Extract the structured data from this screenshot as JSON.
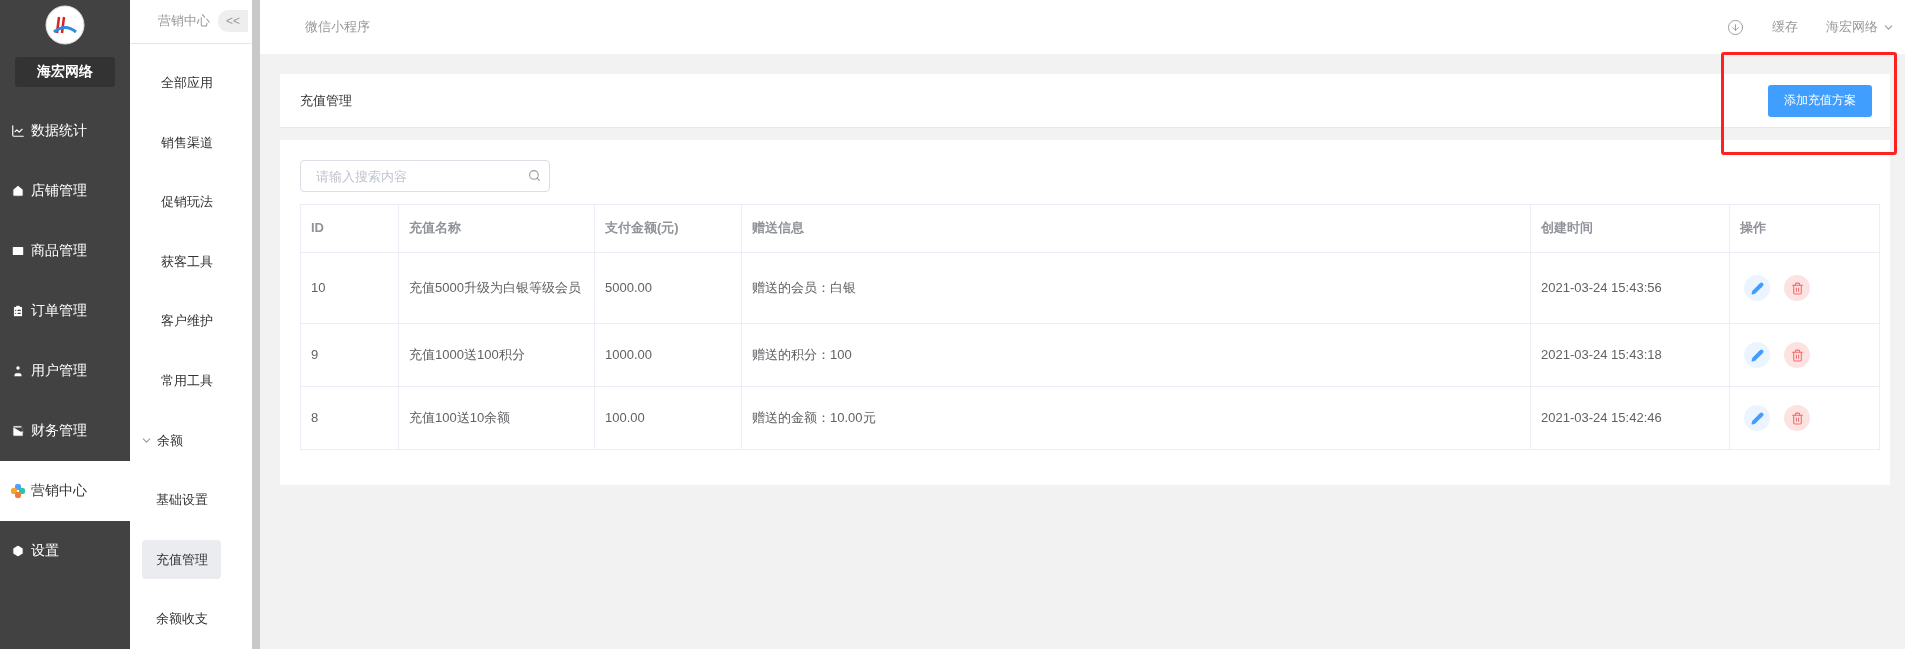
{
  "brand": {
    "name": "海宏网络"
  },
  "main_nav": [
    {
      "label": "数据统计",
      "selected": false
    },
    {
      "label": "店铺管理",
      "selected": false
    },
    {
      "label": "商品管理",
      "selected": false
    },
    {
      "label": "订单管理",
      "selected": false
    },
    {
      "label": "用户管理",
      "selected": false
    },
    {
      "label": "财务管理",
      "selected": false
    },
    {
      "label": "营销中心",
      "selected": true
    },
    {
      "label": "设置",
      "selected": false
    }
  ],
  "sub_nav": {
    "title": "营销中心",
    "collapse": "<<",
    "items": [
      {
        "kind": "link",
        "label": "全部应用",
        "selected": false
      },
      {
        "kind": "link",
        "label": "销售渠道",
        "selected": false
      },
      {
        "kind": "link",
        "label": "促销玩法",
        "selected": false
      },
      {
        "kind": "link",
        "label": "获客工具",
        "selected": false
      },
      {
        "kind": "link",
        "label": "客户维护",
        "selected": false
      },
      {
        "kind": "link",
        "label": "常用工具",
        "selected": false
      },
      {
        "kind": "group",
        "label": "余额",
        "expanded": true,
        "children": [
          {
            "label": "基础设置",
            "selected": false
          },
          {
            "label": "充值管理",
            "selected": true
          },
          {
            "label": "余额收支",
            "selected": false
          }
        ]
      }
    ]
  },
  "top_bar": {
    "app": "微信小程序",
    "cache": "缓存",
    "user": "海宏网络"
  },
  "page": {
    "title": "充值管理",
    "add_button": "添加充值方案",
    "add_button_highlighted": true
  },
  "search": {
    "placeholder": "请输入搜索内容"
  },
  "table": {
    "columns": [
      "ID",
      "充值名称",
      "支付金额(元)",
      "赠送信息",
      "创建时间",
      "操作"
    ],
    "rows": [
      {
        "id": "10",
        "name": "充值5000升级为白银等级会员",
        "amount": "5000.00",
        "gift": "赠送的会员：白银",
        "created": "2021-03-24 15:43:56"
      },
      {
        "id": "9",
        "name": "充值1000送100积分",
        "amount": "1000.00",
        "gift": "赠送的积分：100",
        "created": "2021-03-24 15:43:18"
      },
      {
        "id": "8",
        "name": "充值100送10余额",
        "amount": "100.00",
        "gift": "赠送的金额：10.00元",
        "created": "2021-03-24 15:42:46"
      }
    ]
  }
}
